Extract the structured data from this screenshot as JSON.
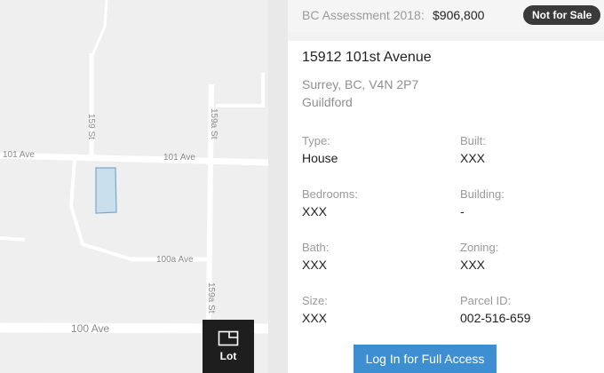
{
  "map": {
    "streets": {
      "ave_101_left": "101 Ave",
      "ave_101_right": "101 Ave",
      "st_159": "159 St",
      "st_159a_upper": "159a St",
      "st_159a_lower": "159a St",
      "ave_100a": "100a Ave",
      "ave_100": "100 Ave"
    },
    "lot_button": {
      "label": "Lot",
      "icon": "lot-frame-icon"
    },
    "parcel_color": "#c9dfec",
    "parcel_stroke": "#7aa8c8"
  },
  "header": {
    "assessment_label": "BC Assessment 2018:",
    "assessment_value": "$906,800",
    "status_badge": "Not for Sale"
  },
  "property": {
    "address": "15912 101st Avenue",
    "city_line": "Surrey, BC, V4N 2P7",
    "neighbourhood": "Guildford"
  },
  "details": [
    {
      "label": "Type:",
      "value": "House"
    },
    {
      "label": "Built:",
      "value": "XXX"
    },
    {
      "label": "Bedrooms:",
      "value": "XXX"
    },
    {
      "label": "Building:",
      "value": "-"
    },
    {
      "label": "Bath:",
      "value": "XXX"
    },
    {
      "label": "Zoning:",
      "value": "XXX"
    },
    {
      "label": "Size:",
      "value": "XXX"
    },
    {
      "label": "Parcel ID:",
      "value": "002-516-659"
    }
  ],
  "actions": {
    "login_label": "Log In for Full Access"
  },
  "colors": {
    "accent": "#3d8fd2",
    "badge": "#3a3a3a",
    "lot_button": "#1e1e1e"
  }
}
